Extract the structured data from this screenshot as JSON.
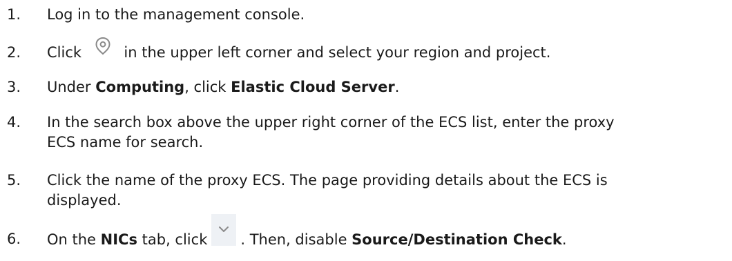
{
  "steps": [
    {
      "num": "1.",
      "text": "Log in to the management console."
    },
    {
      "num": "2.",
      "pre": "Click",
      "icon": "location-pin-icon",
      "post": "in the upper left corner and select your region and project."
    },
    {
      "num": "3.",
      "pre": "Under ",
      "bold1": "Computing",
      "mid": ", click ",
      "bold2": "Elastic Cloud Server",
      "post": "."
    },
    {
      "num": "4.",
      "line1": "In the search box above the upper right corner of the ECS list, enter the proxy",
      "line2": "ECS name for search."
    },
    {
      "num": "5.",
      "line1": "Click the name of the proxy ECS. The page providing details about the ECS is",
      "line2": "displayed."
    },
    {
      "num": "6.",
      "pre": "On the ",
      "bold1": "NICs",
      "mid": " tab, click",
      "icon": "chevron-down-icon",
      "post": ". Then, disable ",
      "bold2": "Source/Destination Check",
      "end": "."
    }
  ]
}
